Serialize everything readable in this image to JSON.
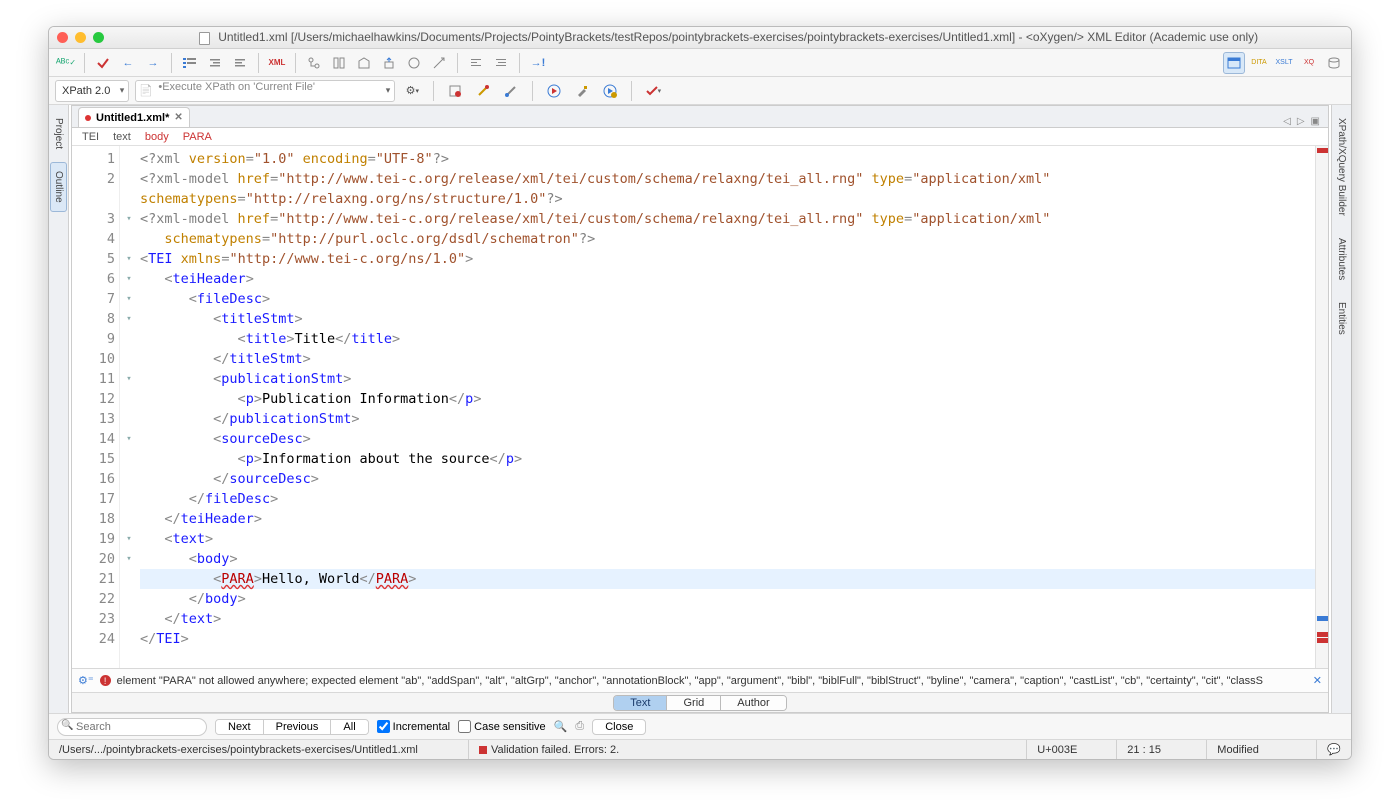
{
  "window": {
    "title": "Untitled1.xml [/Users/michaelhawkins/Documents/Projects/PointyBrackets/testRepos/pointybrackets-exercises/pointybrackets-exercises/Untitled1.xml] - <oXygen/> XML Editor (Academic use only)"
  },
  "xpath": {
    "version_label": "XPath 2.0",
    "placeholder": "Execute XPath on  'Current File'"
  },
  "left_rail": {
    "project": "Project",
    "outline": "Outline"
  },
  "right_rail": {
    "xpath_builder": "XPath/XQuery Builder",
    "attributes": "Attributes",
    "entities": "Entities"
  },
  "file_tab": {
    "name": "Untitled1.xml*"
  },
  "breadcrumb": [
    "TEI",
    "text",
    "body",
    "PARA"
  ],
  "code_lines": [
    {
      "n": 1,
      "fold": "",
      "seg": [
        {
          "c": "pi",
          "t": "<?xml"
        },
        {
          "c": "txt",
          "t": " "
        },
        {
          "c": "attn",
          "t": "version"
        },
        {
          "c": "punc",
          "t": "="
        },
        {
          "c": "attv",
          "t": "\"1.0\""
        },
        {
          "c": "txt",
          "t": " "
        },
        {
          "c": "attn",
          "t": "encoding"
        },
        {
          "c": "punc",
          "t": "="
        },
        {
          "c": "attv",
          "t": "\"UTF-8\""
        },
        {
          "c": "pi",
          "t": "?>"
        }
      ]
    },
    {
      "n": 2,
      "fold": "",
      "seg": [
        {
          "c": "pi",
          "t": "<?xml-model"
        },
        {
          "c": "txt",
          "t": " "
        },
        {
          "c": "attn",
          "t": "href"
        },
        {
          "c": "punc",
          "t": "="
        },
        {
          "c": "attv",
          "t": "\"http://www.tei-c.org/release/xml/tei/custom/schema/relaxng/tei_all.rng\""
        },
        {
          "c": "txt",
          "t": " "
        },
        {
          "c": "attn",
          "t": "type"
        },
        {
          "c": "punc",
          "t": "="
        },
        {
          "c": "attv",
          "t": "\"application/xml\""
        }
      ]
    },
    {
      "n": 2,
      "dup": true,
      "fold": "",
      "seg": [
        {
          "c": "attn",
          "t": "schematypens"
        },
        {
          "c": "punc",
          "t": "="
        },
        {
          "c": "attv",
          "t": "\"http://relaxng.org/ns/structure/1.0\""
        },
        {
          "c": "pi",
          "t": "?>"
        }
      ]
    },
    {
      "n": 3,
      "fold": "▾",
      "seg": [
        {
          "c": "pi",
          "t": "<?xml-model"
        },
        {
          "c": "txt",
          "t": " "
        },
        {
          "c": "attn",
          "t": "href"
        },
        {
          "c": "punc",
          "t": "="
        },
        {
          "c": "attv",
          "t": "\"http://www.tei-c.org/release/xml/tei/custom/schema/relaxng/tei_all.rng\""
        },
        {
          "c": "txt",
          "t": " "
        },
        {
          "c": "attn",
          "t": "type"
        },
        {
          "c": "punc",
          "t": "="
        },
        {
          "c": "attv",
          "t": "\"application/xml\""
        }
      ]
    },
    {
      "n": 4,
      "fold": "",
      "indent": "   ",
      "seg": [
        {
          "c": "attn",
          "t": "schematypens"
        },
        {
          "c": "punc",
          "t": "="
        },
        {
          "c": "attv",
          "t": "\"http://purl.oclc.org/dsdl/schematron\""
        },
        {
          "c": "pi",
          "t": "?>"
        }
      ]
    },
    {
      "n": 5,
      "fold": "▾",
      "seg": [
        {
          "c": "punc",
          "t": "<"
        },
        {
          "c": "tag",
          "t": "TEI"
        },
        {
          "c": "txt",
          "t": " "
        },
        {
          "c": "attn",
          "t": "xmlns"
        },
        {
          "c": "punc",
          "t": "="
        },
        {
          "c": "attv",
          "t": "\"http://www.tei-c.org/ns/1.0\""
        },
        {
          "c": "punc",
          "t": ">"
        }
      ]
    },
    {
      "n": 6,
      "fold": "▾",
      "indent": "   ",
      "seg": [
        {
          "c": "punc",
          "t": "<"
        },
        {
          "c": "tag",
          "t": "teiHeader"
        },
        {
          "c": "punc",
          "t": ">"
        }
      ]
    },
    {
      "n": 7,
      "fold": "▾",
      "indent": "      ",
      "seg": [
        {
          "c": "punc",
          "t": "<"
        },
        {
          "c": "tag",
          "t": "fileDesc"
        },
        {
          "c": "punc",
          "t": ">"
        }
      ]
    },
    {
      "n": 8,
      "fold": "▾",
      "indent": "         ",
      "seg": [
        {
          "c": "punc",
          "t": "<"
        },
        {
          "c": "tag",
          "t": "titleStmt"
        },
        {
          "c": "punc",
          "t": ">"
        }
      ]
    },
    {
      "n": 9,
      "fold": "",
      "indent": "            ",
      "seg": [
        {
          "c": "punc",
          "t": "<"
        },
        {
          "c": "tag",
          "t": "title"
        },
        {
          "c": "punc",
          "t": ">"
        },
        {
          "c": "txt",
          "t": "Title"
        },
        {
          "c": "punc",
          "t": "</"
        },
        {
          "c": "tag",
          "t": "title"
        },
        {
          "c": "punc",
          "t": ">"
        }
      ]
    },
    {
      "n": 10,
      "fold": "",
      "indent": "         ",
      "seg": [
        {
          "c": "punc",
          "t": "</"
        },
        {
          "c": "tag",
          "t": "titleStmt"
        },
        {
          "c": "punc",
          "t": ">"
        }
      ]
    },
    {
      "n": 11,
      "fold": "▾",
      "indent": "         ",
      "seg": [
        {
          "c": "punc",
          "t": "<"
        },
        {
          "c": "tag",
          "t": "publicationStmt"
        },
        {
          "c": "punc",
          "t": ">"
        }
      ]
    },
    {
      "n": 12,
      "fold": "",
      "indent": "            ",
      "seg": [
        {
          "c": "punc",
          "t": "<"
        },
        {
          "c": "tag",
          "t": "p"
        },
        {
          "c": "punc",
          "t": ">"
        },
        {
          "c": "txt",
          "t": "Publication Information"
        },
        {
          "c": "punc",
          "t": "</"
        },
        {
          "c": "tag",
          "t": "p"
        },
        {
          "c": "punc",
          "t": ">"
        }
      ]
    },
    {
      "n": 13,
      "fold": "",
      "indent": "         ",
      "seg": [
        {
          "c": "punc",
          "t": "</"
        },
        {
          "c": "tag",
          "t": "publicationStmt"
        },
        {
          "c": "punc",
          "t": ">"
        }
      ]
    },
    {
      "n": 14,
      "fold": "▾",
      "indent": "         ",
      "seg": [
        {
          "c": "punc",
          "t": "<"
        },
        {
          "c": "tag",
          "t": "sourceDesc"
        },
        {
          "c": "punc",
          "t": ">"
        }
      ]
    },
    {
      "n": 15,
      "fold": "",
      "indent": "            ",
      "seg": [
        {
          "c": "punc",
          "t": "<"
        },
        {
          "c": "tag",
          "t": "p"
        },
        {
          "c": "punc",
          "t": ">"
        },
        {
          "c": "txt",
          "t": "Information about the source"
        },
        {
          "c": "punc",
          "t": "</"
        },
        {
          "c": "tag",
          "t": "p"
        },
        {
          "c": "punc",
          "t": ">"
        }
      ]
    },
    {
      "n": 16,
      "fold": "",
      "indent": "         ",
      "seg": [
        {
          "c": "punc",
          "t": "</"
        },
        {
          "c": "tag",
          "t": "sourceDesc"
        },
        {
          "c": "punc",
          "t": ">"
        }
      ]
    },
    {
      "n": 17,
      "fold": "",
      "indent": "      ",
      "seg": [
        {
          "c": "punc",
          "t": "</"
        },
        {
          "c": "tag",
          "t": "fileDesc"
        },
        {
          "c": "punc",
          "t": ">"
        }
      ]
    },
    {
      "n": 18,
      "fold": "",
      "indent": "   ",
      "seg": [
        {
          "c": "punc",
          "t": "</"
        },
        {
          "c": "tag",
          "t": "teiHeader"
        },
        {
          "c": "punc",
          "t": ">"
        }
      ]
    },
    {
      "n": 19,
      "fold": "▾",
      "indent": "   ",
      "seg": [
        {
          "c": "punc",
          "t": "<"
        },
        {
          "c": "tag",
          "t": "text"
        },
        {
          "c": "punc",
          "t": ">"
        }
      ]
    },
    {
      "n": 20,
      "fold": "▾",
      "indent": "      ",
      "seg": [
        {
          "c": "punc",
          "t": "<"
        },
        {
          "c": "tag",
          "t": "body"
        },
        {
          "c": "punc",
          "t": ">"
        }
      ]
    },
    {
      "n": 21,
      "fold": "",
      "hl": true,
      "bulb": true,
      "indent": "         ",
      "seg": [
        {
          "c": "punc",
          "t": "<"
        },
        {
          "c": "etag",
          "t": "PARA"
        },
        {
          "c": "punc",
          "t": ">"
        },
        {
          "c": "txt",
          "t": "Hello, World"
        },
        {
          "c": "punc",
          "t": "</"
        },
        {
          "c": "etag",
          "t": "PARA"
        },
        {
          "c": "punc",
          "t": ">"
        }
      ]
    },
    {
      "n": 22,
      "fold": "",
      "indent": "      ",
      "seg": [
        {
          "c": "punc",
          "t": "</"
        },
        {
          "c": "tag",
          "t": "body"
        },
        {
          "c": "punc",
          "t": ">"
        }
      ]
    },
    {
      "n": 23,
      "fold": "",
      "indent": "   ",
      "seg": [
        {
          "c": "punc",
          "t": "</"
        },
        {
          "c": "tag",
          "t": "text"
        },
        {
          "c": "punc",
          "t": ">"
        }
      ]
    },
    {
      "n": 24,
      "fold": "",
      "seg": [
        {
          "c": "punc",
          "t": "</"
        },
        {
          "c": "tag",
          "t": "TEI"
        },
        {
          "c": "punc",
          "t": ">"
        }
      ]
    }
  ],
  "error_message": "element \"PARA\" not allowed anywhere; expected element \"ab\", \"addSpan\", \"alt\", \"altGrp\", \"anchor\", \"annotationBlock\", \"app\", \"argument\", \"bibl\", \"biblFull\", \"biblStruct\", \"byline\", \"camera\", \"caption\", \"castList\", \"cb\", \"certainty\", \"cit\", \"classS",
  "view_modes": [
    "Text",
    "Grid",
    "Author"
  ],
  "find": {
    "placeholder": "Search",
    "next": "Next",
    "prev": "Previous",
    "all": "All",
    "incremental": "Incremental",
    "case": "Case sensitive",
    "close": "Close"
  },
  "status": {
    "path": "/Users/.../pointybrackets-exercises/pointybrackets-exercises/Untitled1.xml",
    "validation": "Validation failed. Errors: 2.",
    "charcode": "U+003E",
    "caret": "21 : 15",
    "modified": "Modified"
  }
}
